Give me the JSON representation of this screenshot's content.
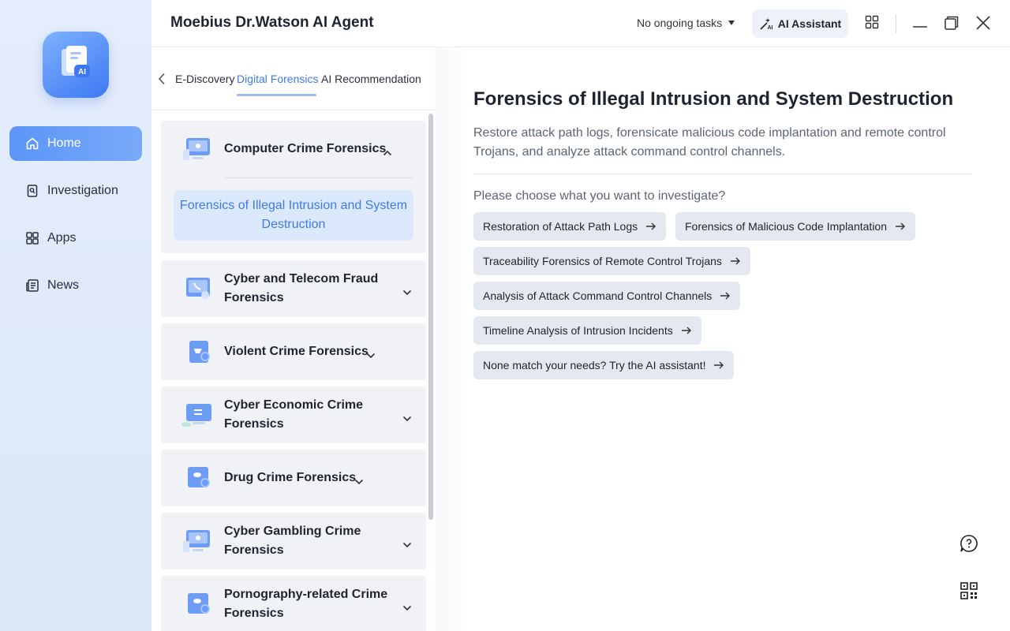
{
  "app": {
    "title": "Moebius Dr.Watson AI Agent"
  },
  "nav": {
    "items": [
      {
        "label": "Home",
        "icon": "home-icon",
        "active": true
      },
      {
        "label": "Investigation",
        "icon": "investigation-icon"
      },
      {
        "label": "Apps",
        "icon": "apps-icon"
      },
      {
        "label": "News",
        "icon": "news-icon"
      }
    ]
  },
  "topbar": {
    "tasks_label": "No ongoing tasks",
    "ai_button": "AI Assistant"
  },
  "tabs": {
    "items": [
      "E-Discovery",
      "Digital Forensics",
      "AI Recommendation"
    ],
    "active": "Digital Forensics"
  },
  "categories": [
    {
      "title": "Computer Crime Forensics",
      "expanded": true,
      "sub": [
        "Forensics of Illegal Intrusion and System Destruction"
      ]
    },
    {
      "title": "Cyber and Telecom Fraud Forensics"
    },
    {
      "title": "Violent Crime Forensics"
    },
    {
      "title": "Cyber Economic Crime Forensics"
    },
    {
      "title": "Drug Crime Forensics"
    },
    {
      "title": "Cyber Gambling Crime Forensics"
    },
    {
      "title": "Pornography-related Crime Forensics"
    }
  ],
  "detail": {
    "title": "Forensics of Illegal Intrusion and System Destruction",
    "description": "Restore attack path logs, forensicate malicious code implantation and remote control Trojans, and analyze attack command control channels.",
    "prompt": "Please choose what you want to investigate?",
    "options": [
      "Restoration of Attack Path Logs",
      "Forensics of Malicious Code Implantation",
      "Traceability Forensics of Remote Control Trojans",
      "Analysis of Attack Command Control Channels",
      "Timeline Analysis of Intrusion Incidents",
      "None match your needs? Try the AI assistant!"
    ]
  },
  "colors": {
    "accent": "#3f7be8",
    "nav_active": "#5b95f7"
  }
}
